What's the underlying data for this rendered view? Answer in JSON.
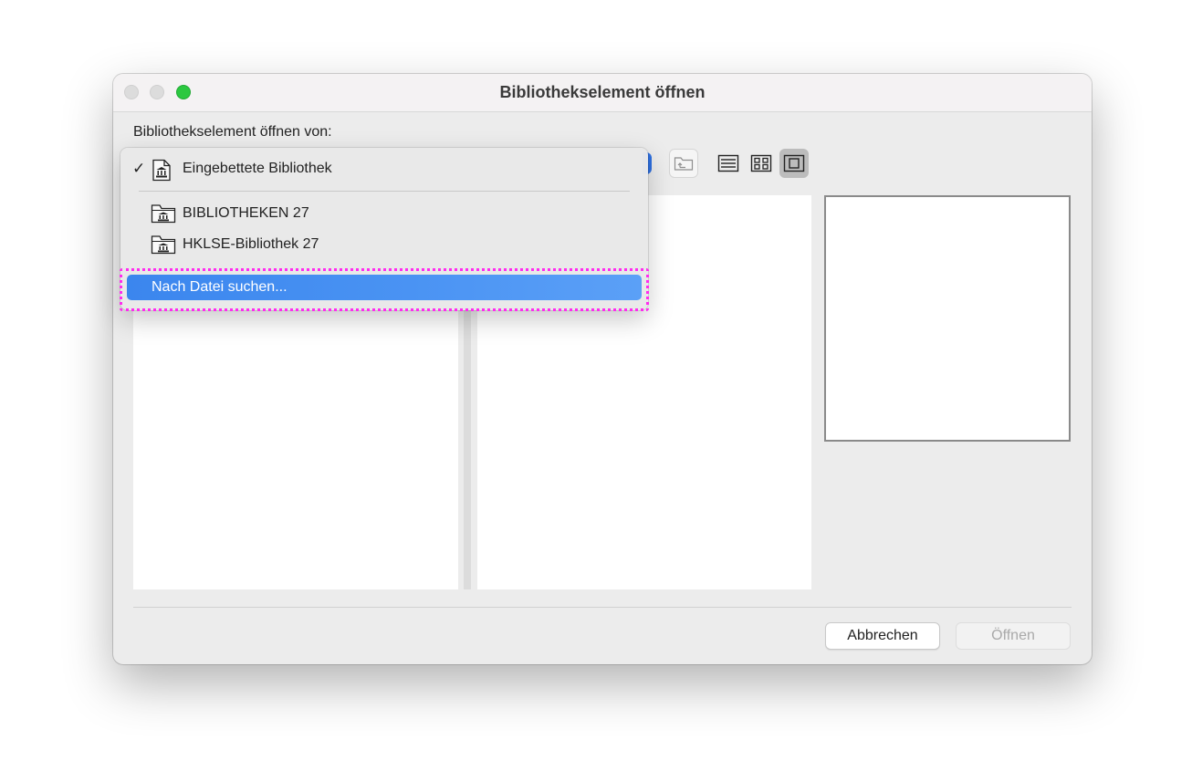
{
  "window": {
    "title": "Bibliothekselement öffnen"
  },
  "source": {
    "label": "Bibliothekselement öffnen von:"
  },
  "toolbar": {
    "up_icon": "folder-up-icon",
    "list_view_icon": "list-view-icon",
    "grid_view_icon": "grid-view-icon",
    "single_view_icon": "single-view-icon",
    "active_view": "single"
  },
  "menu": {
    "items": [
      {
        "label": "Eingebettete Bibliothek",
        "checked": true,
        "icon": "library-document-icon"
      },
      {
        "label": "BIBLIOTHEKEN 27",
        "checked": false,
        "icon": "library-folder-icon"
      },
      {
        "label": "HKLSE-Bibliothek 27",
        "checked": false,
        "icon": "library-folder-icon"
      }
    ],
    "search_label": "Nach Datei suchen...",
    "highlight_color": "#ff2bef",
    "selection_color": "#3b86ee"
  },
  "buttons": {
    "cancel": "Abbrechen",
    "open": "Öffnen",
    "open_enabled": false
  }
}
